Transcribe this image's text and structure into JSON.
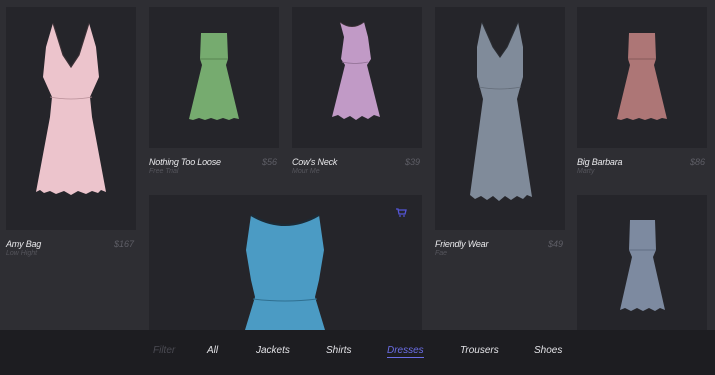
{
  "products": [
    {
      "name": "Amy Bag",
      "brand": "Low Hight",
      "price": "$167",
      "color": "#ecc4cc"
    },
    {
      "name": "Nothing Too Loose",
      "brand": "Free Trial",
      "price": "$56",
      "color": "#76ab6f"
    },
    {
      "name": "Cow's Neck",
      "brand": "Mour Me",
      "price": "$39",
      "color": "#c19ac6"
    },
    {
      "name": "Friendly Wear",
      "brand": "Fae",
      "price": "$49",
      "color": "#808b9a"
    },
    {
      "name": "Big Barbara",
      "brand": "Marty",
      "price": "$86",
      "color": "#ad7676"
    },
    {
      "featured_color": "#4b9bc4"
    },
    {
      "color": "#7d8aa0"
    }
  ],
  "featured_cart_icon_color": "#5556d6",
  "nav": {
    "filter_label": "Filter",
    "items": [
      "All",
      "Jackets",
      "Shirts",
      "Dresses",
      "Trousers",
      "Shoes"
    ],
    "active": "Dresses"
  }
}
